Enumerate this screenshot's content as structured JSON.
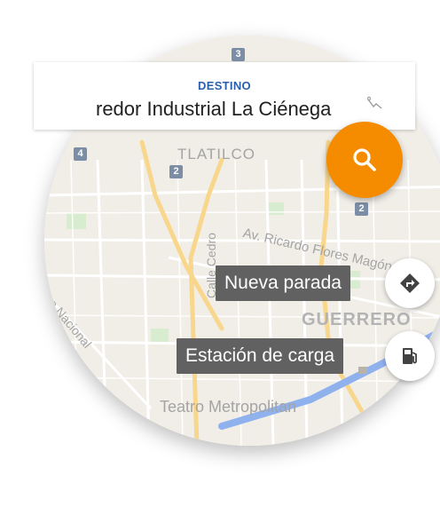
{
  "destination": {
    "label": "DESTINO",
    "value": "redor Industrial La Ciénega"
  },
  "map": {
    "labels": {
      "neighborhood_tlatilco": "TLATILCO",
      "neighborhood_guerrero": "GUERRERO",
      "street_ricardo": "Av. Ricardo Flores Magón",
      "street_cedro": "Calle Cedro",
      "street_nacional": "a Nacional",
      "poi_teatro": "Teatro Metropolitan"
    },
    "highway_shields": [
      "3",
      "4",
      "2",
      "2"
    ]
  },
  "actions": {
    "search_icon": "search-icon",
    "route_icon": "directions-icon",
    "fuel_icon": "gas-station-icon",
    "new_stop_label": "Nueva parada",
    "charging_station_label": "Estación de carga"
  },
  "colors": {
    "accent_orange": "#f58c00",
    "destination_label_blue": "#2c5fab",
    "route_blue": "#8fb1ee",
    "tooltip_bg": "#616161"
  }
}
